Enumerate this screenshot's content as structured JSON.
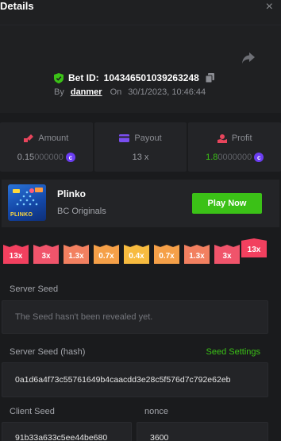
{
  "header": {
    "title": "Details",
    "close_glyph": "×"
  },
  "bet": {
    "id_label": "Bet ID:",
    "id_value": "104346501039263248",
    "by_label": "By",
    "username": "danmer",
    "on_label": "On",
    "datetime": "30/1/2023, 10:46:44"
  },
  "stats": {
    "amount": {
      "label": "Amount",
      "main": "0.15",
      "dim": "000000"
    },
    "payout": {
      "label": "Payout",
      "value": "13 x"
    },
    "profit": {
      "label": "Profit",
      "main": "1.8",
      "dim": "0000000"
    }
  },
  "game": {
    "name": "Plinko",
    "provider": "BC Originals",
    "play_label": "Play Now",
    "thumb_text": "PLINKO"
  },
  "buckets": [
    "13x",
    "3x",
    "1.3x",
    "0.7x",
    "0.4x",
    "0.7x",
    "1.3x",
    "3x",
    "13x"
  ],
  "server_seed": {
    "label": "Server Seed",
    "placeholder": "The Seed hasn't been revealed yet."
  },
  "server_seed_hash": {
    "label": "Server Seed (hash)",
    "settings_label": "Seed Settings",
    "value": "0a1d6a4f73c55761649b4caacdd3e28c5f576d7c792e62eb"
  },
  "client_seed": {
    "label": "Client Seed",
    "value": "91b33a633c5ee44be680"
  },
  "nonce": {
    "label": "nonce",
    "value": "3600"
  },
  "colors": {
    "accent_green": "#3bc117",
    "coin_purple": "#6b3df2",
    "bucket_red": "#f2405f",
    "bucket_yellow": "#f7bb3f"
  },
  "icons": {
    "close": "close-icon",
    "share": "share-icon",
    "verified": "shield-check-icon",
    "copy": "copy-icon",
    "amount": "amount-icon",
    "payout": "wallet-icon",
    "profit": "profit-icon",
    "currency": "coin-icon"
  }
}
